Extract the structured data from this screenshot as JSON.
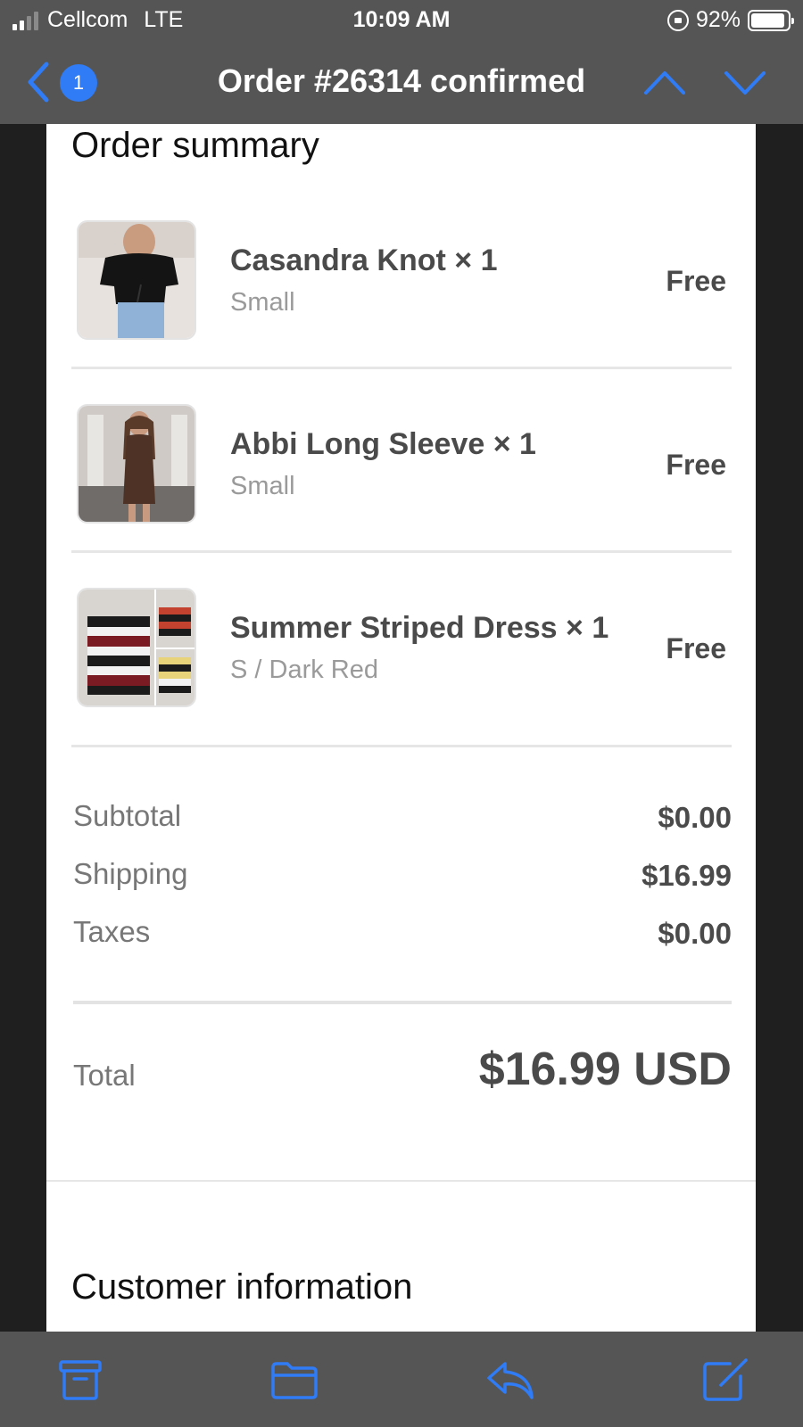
{
  "status_bar": {
    "carrier": "Cellcom",
    "network": "LTE",
    "time": "10:09 AM",
    "battery": "92%"
  },
  "nav": {
    "badge_count": "1",
    "title": "Order #26314 confirmed"
  },
  "order_summary": {
    "title": "Order summary",
    "items": [
      {
        "name": "Casandra Knot × 1",
        "variant": "Small",
        "price": "Free"
      },
      {
        "name": "Abbi Long Sleeve × 1",
        "variant": "Small",
        "price": "Free"
      },
      {
        "name": "Summer Striped Dress × 1",
        "variant": "S / Dark Red",
        "price": "Free"
      }
    ],
    "subtotal_label": "Subtotal",
    "subtotal_value": "$0.00",
    "shipping_label": "Shipping",
    "shipping_value": "$16.99",
    "taxes_label": "Taxes",
    "taxes_value": "$0.00",
    "total_label": "Total",
    "total_value": "$16.99 USD"
  },
  "customer_info": {
    "title": "Customer information"
  },
  "toolbar": {
    "icons": [
      "archive-icon",
      "folder-icon",
      "reply-icon",
      "compose-icon"
    ]
  },
  "colors": {
    "accent": "#2f7cf6",
    "bar": "#555555",
    "text_dark": "#4a4a4a",
    "text_muted": "#9a9a9a"
  }
}
